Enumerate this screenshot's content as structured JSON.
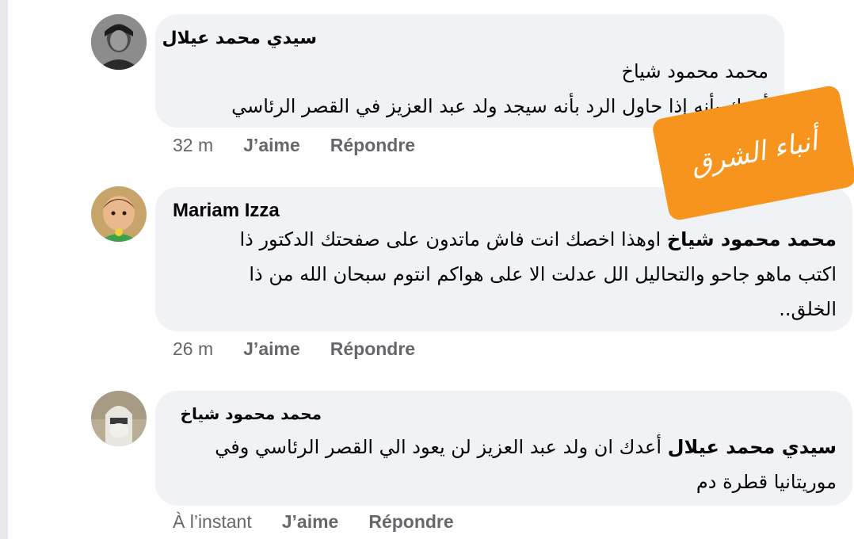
{
  "comments": [
    {
      "author": "سيدي محمد عيلال",
      "mention": "",
      "lines": [
        "محمد محمود شياخ",
        "أعدك بأنه إذا حاول الرد بأنه سيجد ولد عبد العزيز في القصر الرئاسي"
      ],
      "time": "32 m",
      "like": "J’aime",
      "reply": "Répondre"
    },
    {
      "author": "Mariam Izza",
      "mention": "محمد محمود شياخ",
      "lines": [
        "اوهذا اخصك انت فاش ماتدون على صفحتك الدكتور ذا",
        "اكتب ماهو جاحو والتحاليل الل عدلت الا على هواكم انتوم سبحان الله من ذا",
        "الخلق.."
      ],
      "time": "26 m",
      "like": "J’aime",
      "reply": "Répondre"
    },
    {
      "author": "محمد محمود شياخ",
      "mention": "سيدي محمد عيلال",
      "lines": [
        "أعدك ان ولد عبد العزيز لن يعود الي القصر الرئاسي وفي",
        "موريتانيا قطرة دم"
      ],
      "time": "À l’instant",
      "like": "J’aime",
      "reply": "Répondre"
    }
  ],
  "watermark": {
    "text": "أنباء الشرق",
    "color": "#f7941d"
  },
  "colors": {
    "bubble": "#f0f2f5",
    "meta": "#65676b",
    "text": "#050505"
  }
}
